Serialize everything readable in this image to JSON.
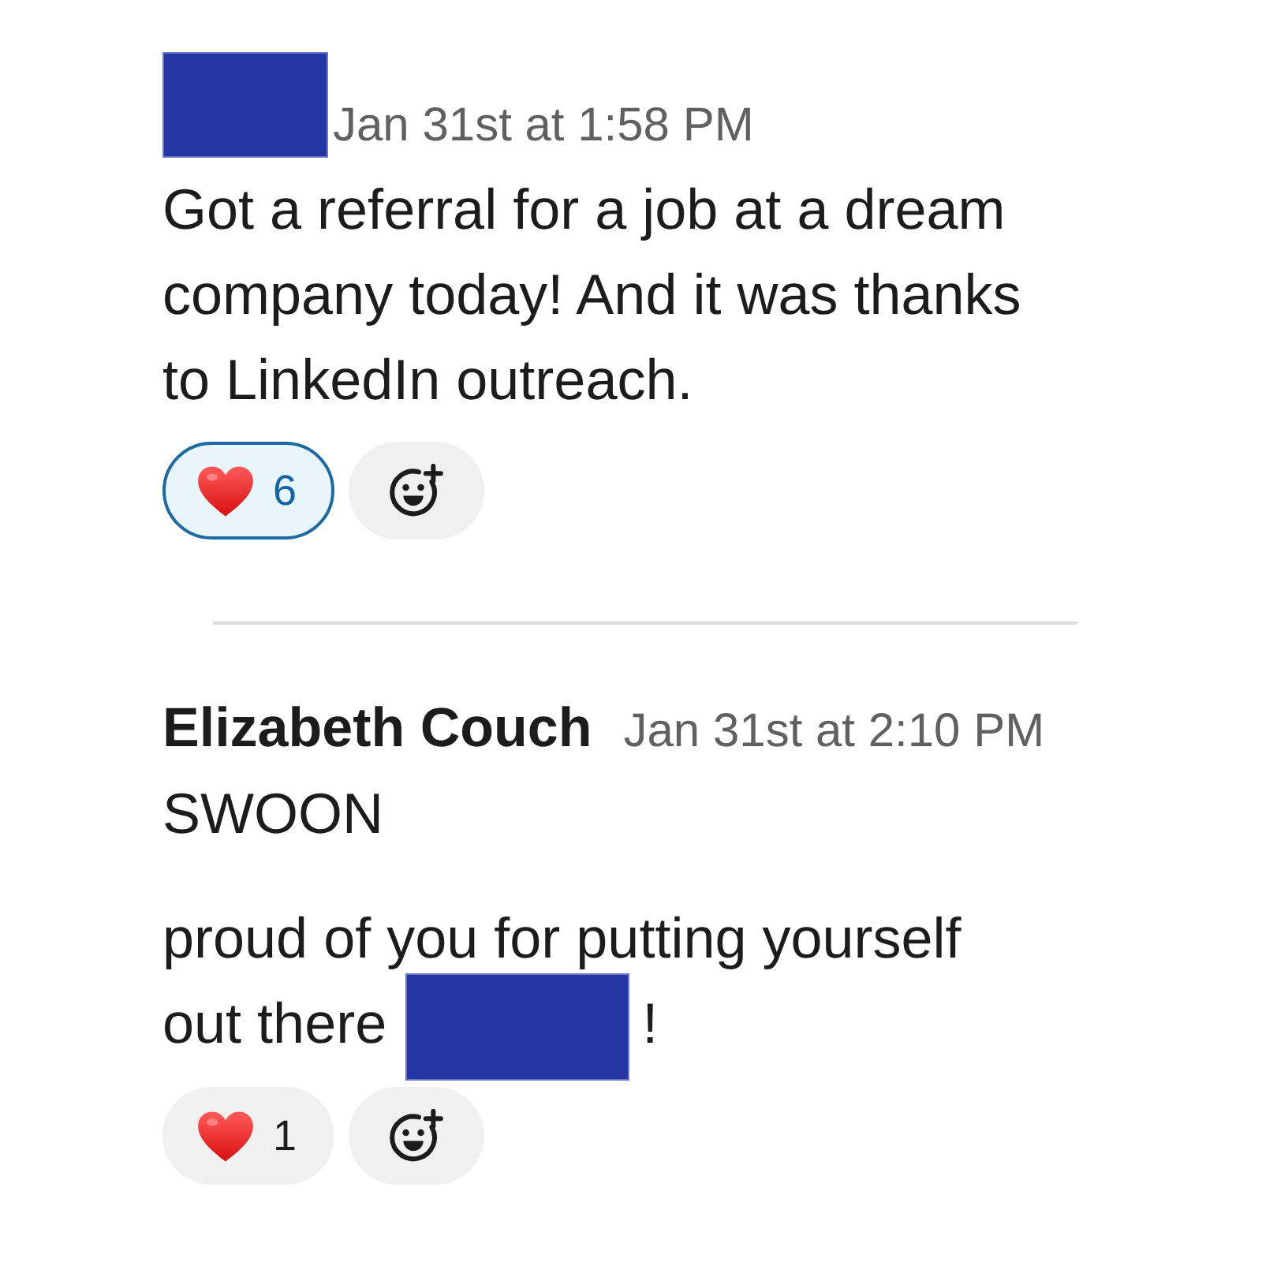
{
  "messages": [
    {
      "author": {
        "kind": "redacted"
      },
      "timestamp": "Jan 31st at 1:58 PM",
      "paragraphs": [
        [
          [
            {
              "kind": "text",
              "text": "Got a referral for a job at a dream company today! And it was thanks to LinkedIn outreach."
            }
          ]
        ]
      ],
      "reactions": [
        {
          "count": "6",
          "selected": true
        }
      ]
    },
    {
      "author": {
        "kind": "name",
        "text": "Elizabeth Couch"
      },
      "timestamp": "Jan 31st at 2:10 PM",
      "paragraphs": [
        [
          [
            {
              "kind": "text",
              "text": "SWOON"
            }
          ]
        ],
        [
          [
            {
              "kind": "text",
              "text": "proud of you for putting yourself"
            }
          ],
          [
            {
              "kind": "text",
              "text": "out there"
            },
            {
              "kind": "redacted"
            },
            {
              "kind": "text",
              "text": "!"
            }
          ]
        ]
      ],
      "reactions": [
        {
          "count": "1",
          "selected": false
        }
      ]
    }
  ]
}
